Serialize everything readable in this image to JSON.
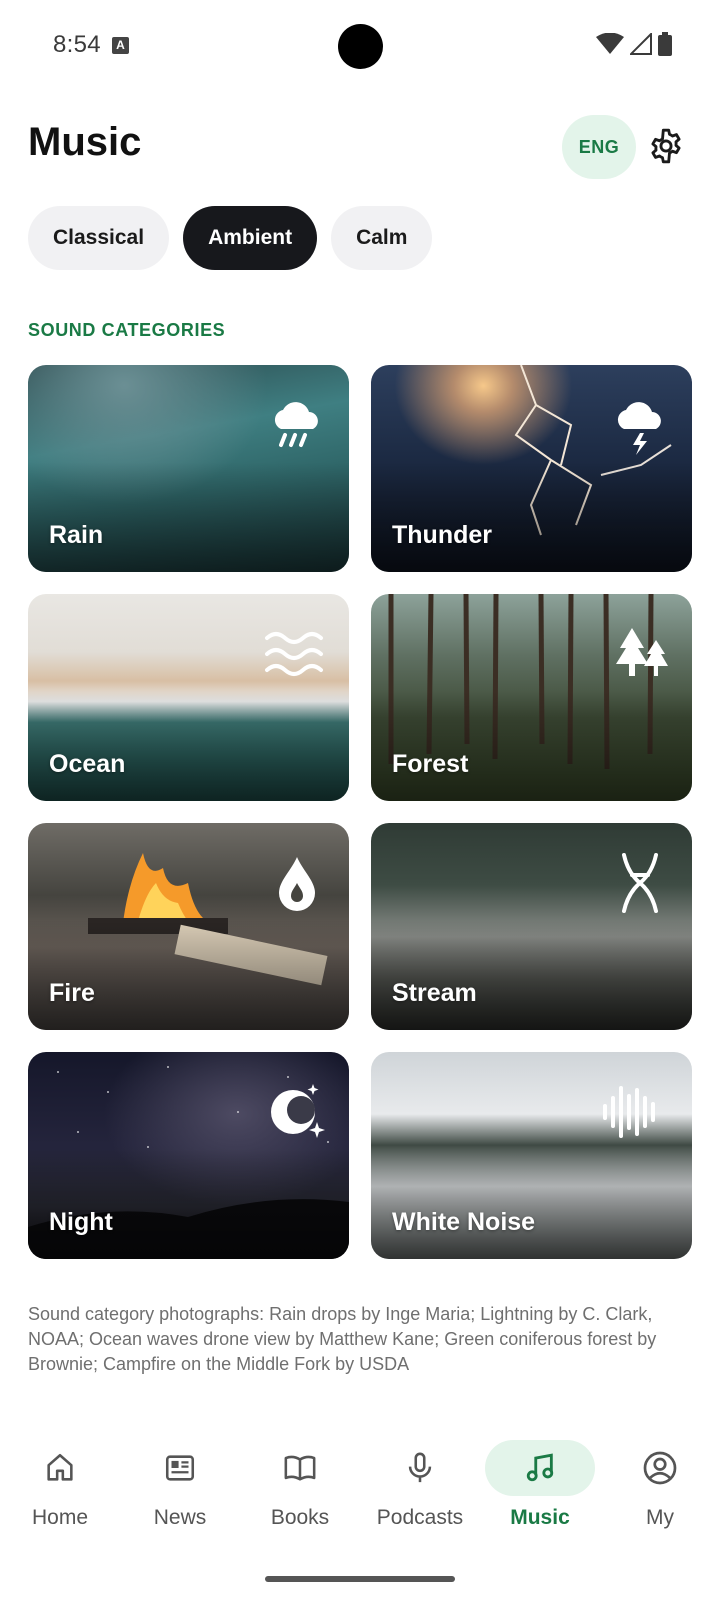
{
  "status_bar": {
    "time": "8:54",
    "notification_icon": "A"
  },
  "header": {
    "title": "Music",
    "language_button": "ENG",
    "settings_icon": "gear-icon"
  },
  "chips": [
    {
      "label": "Classical",
      "selected": false
    },
    {
      "label": "Ambient",
      "selected": true
    },
    {
      "label": "Calm",
      "selected": false
    }
  ],
  "section": {
    "label": "SOUND CATEGORIES"
  },
  "categories": [
    {
      "label": "Rain",
      "icon": "rain-cloud-icon"
    },
    {
      "label": "Thunder",
      "icon": "thunder-cloud-icon"
    },
    {
      "label": "Ocean",
      "icon": "waves-icon"
    },
    {
      "label": "Forest",
      "icon": "trees-icon"
    },
    {
      "label": "Fire",
      "icon": "drop-icon"
    },
    {
      "label": "Stream",
      "icon": "stream-icon"
    },
    {
      "label": "Night",
      "icon": "moon-stars-icon"
    },
    {
      "label": "White Noise",
      "icon": "sound-wave-icon"
    }
  ],
  "credits": "Sound category photographs: Rain drops by Inge Maria; Lightning by C. Clark, NOAA; Ocean waves drone view by Matthew Kane; Green coniferous forest by Brownie; Campfire on the Middle Fork by USDA",
  "nav": [
    {
      "label": "Home",
      "icon": "home-icon",
      "active": false
    },
    {
      "label": "News",
      "icon": "news-icon",
      "active": false
    },
    {
      "label": "Books",
      "icon": "book-icon",
      "active": false
    },
    {
      "label": "Podcasts",
      "icon": "microphone-icon",
      "active": false
    },
    {
      "label": "Music",
      "icon": "music-note-icon",
      "active": true
    },
    {
      "label": "My",
      "icon": "account-icon",
      "active": false
    }
  ],
  "colors": {
    "accent": "#1a7a45",
    "accent_light": "#e3f4ea",
    "chip_active": "#17181c",
    "chip_inactive": "#f1f1f3"
  }
}
